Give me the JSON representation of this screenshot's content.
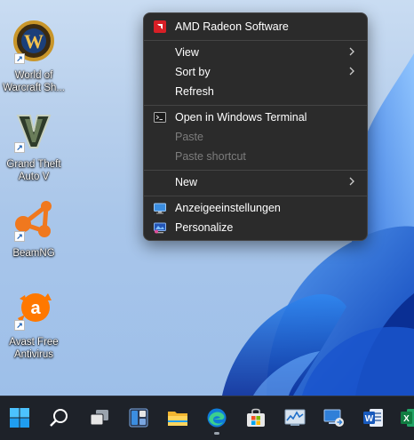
{
  "desktop": {
    "icons": [
      {
        "label": "World of Warcraft Sh...",
        "icon": "world-of-warcraft-icon"
      },
      {
        "label": "Grand Theft Auto V",
        "icon": "gta-v-icon"
      },
      {
        "label": "BeamNG",
        "icon": "beamng-icon"
      },
      {
        "label": "Avast Free Antivirus",
        "icon": "avast-icon"
      }
    ]
  },
  "context_menu": {
    "items": [
      {
        "label": "AMD Radeon Software",
        "icon": "amd-icon"
      },
      {
        "label": "View",
        "submenu": true
      },
      {
        "label": "Sort by",
        "submenu": true
      },
      {
        "label": "Refresh"
      },
      {
        "label": "Open in Windows Terminal",
        "icon": "terminal-icon"
      },
      {
        "label": "Paste",
        "disabled": true
      },
      {
        "label": "Paste shortcut",
        "disabled": true
      },
      {
        "label": "New",
        "submenu": true
      },
      {
        "label": "Anzeigeeinstellungen",
        "icon": "display-settings-icon"
      },
      {
        "label": "Personalize",
        "icon": "personalize-icon"
      }
    ]
  },
  "taskbar": {
    "items": [
      {
        "icon": "start-icon"
      },
      {
        "icon": "search-icon"
      },
      {
        "icon": "task-view-icon"
      },
      {
        "icon": "widgets-icon"
      },
      {
        "icon": "file-explorer-icon"
      },
      {
        "icon": "edge-icon",
        "active": true
      },
      {
        "icon": "store-icon"
      },
      {
        "icon": "performance-monitor-icon"
      },
      {
        "icon": "remote-desktop-icon"
      },
      {
        "icon": "word-icon"
      },
      {
        "icon": "excel-icon"
      }
    ]
  },
  "colors": {
    "menu_bg": "#2b2b2b",
    "taskbar_bg": "#1e2229",
    "accent": "#0078d4"
  }
}
